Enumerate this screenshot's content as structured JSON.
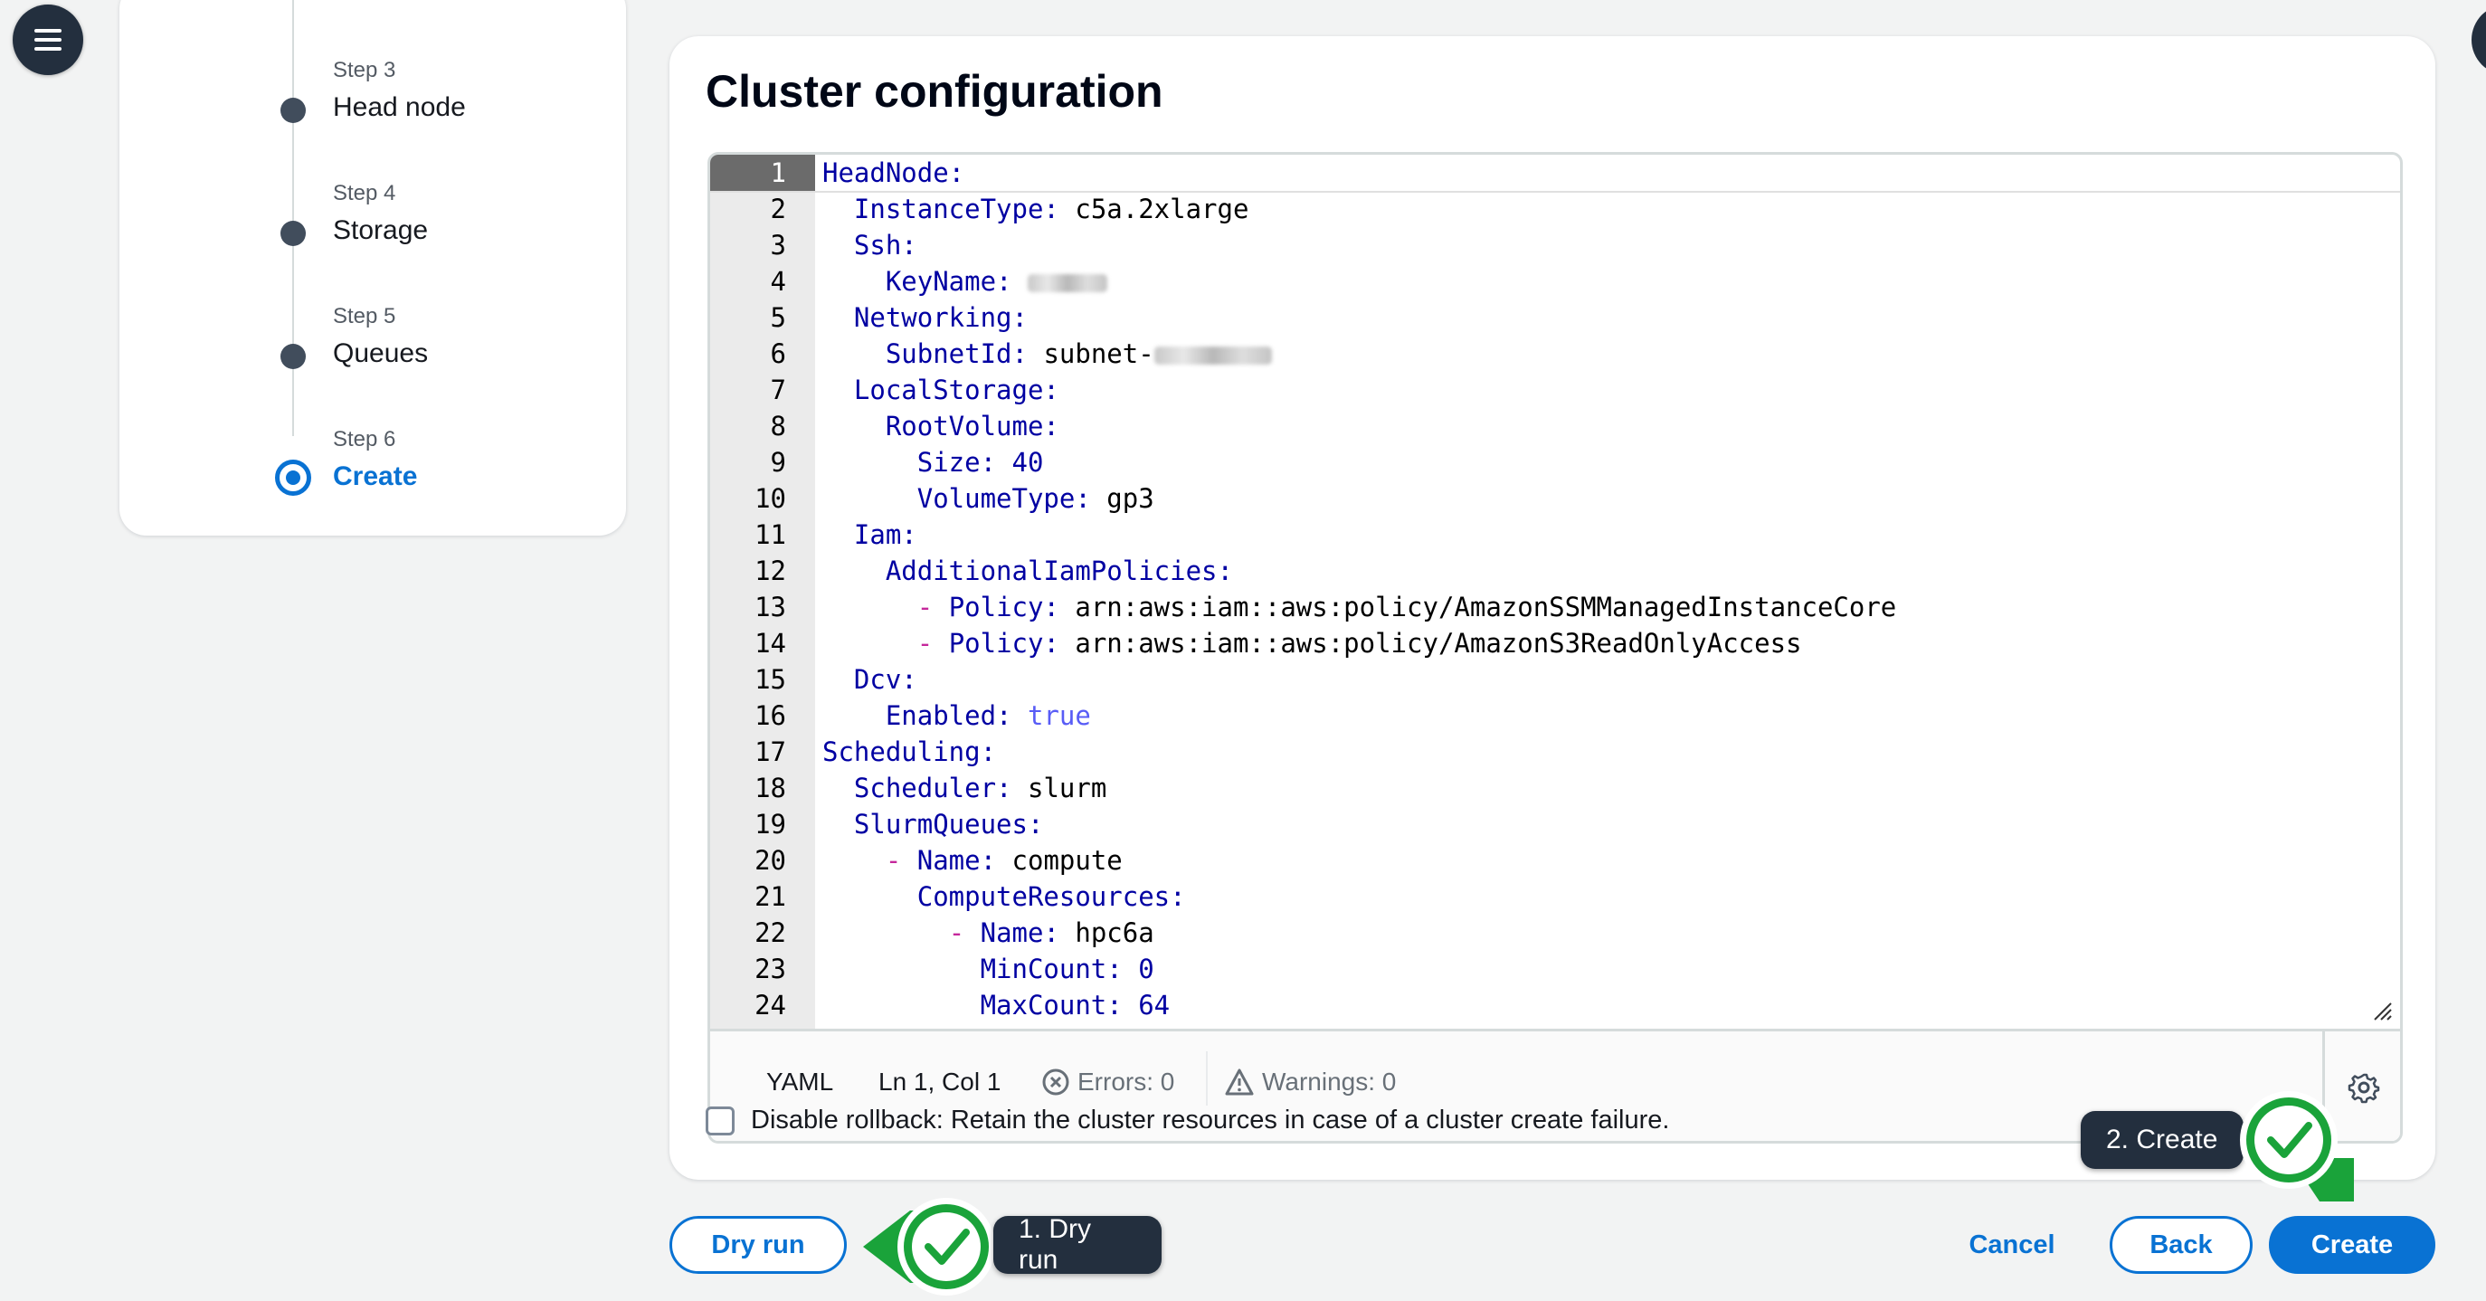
{
  "steps": [
    {
      "num": "Step 3",
      "label": "Head node"
    },
    {
      "num": "Step 4",
      "label": "Storage"
    },
    {
      "num": "Step 5",
      "label": "Queues"
    },
    {
      "num": "Step 6",
      "label": "Create"
    }
  ],
  "main": {
    "title": "Cluster configuration"
  },
  "editor": {
    "language": "YAML",
    "cursor": "Ln 1, Col 1",
    "errors": "Errors: 0",
    "warnings": "Warnings: 0",
    "lines": [
      {
        "n": "1"
      },
      {
        "n": "2"
      },
      {
        "n": "3"
      },
      {
        "n": "4"
      },
      {
        "n": "5"
      },
      {
        "n": "6"
      },
      {
        "n": "7"
      },
      {
        "n": "8"
      },
      {
        "n": "9"
      },
      {
        "n": "10"
      },
      {
        "n": "11"
      },
      {
        "n": "12"
      },
      {
        "n": "13"
      },
      {
        "n": "14"
      },
      {
        "n": "15"
      },
      {
        "n": "16"
      },
      {
        "n": "17"
      },
      {
        "n": "18"
      },
      {
        "n": "19"
      },
      {
        "n": "20"
      },
      {
        "n": "21"
      },
      {
        "n": "22"
      },
      {
        "n": "23"
      },
      {
        "n": "24"
      }
    ],
    "code": {
      "l1_key": "HeadNode:",
      "l2_key": "  InstanceType: ",
      "l2_val": "c5a.2xlarge",
      "l3_key": "  Ssh:",
      "l4_key": "    KeyName: ",
      "l5_key": "  Networking:",
      "l6_key": "    SubnetId: ",
      "l6_val": "subnet-",
      "l7_key": "  LocalStorage:",
      "l8_key": "    RootVolume:",
      "l9_key": "      Size: 40",
      "l10_key": "      VolumeType: ",
      "l10_val": "gp3",
      "l11_key": "  Iam:",
      "l12_key": "    AdditionalIamPolicies:",
      "l13_indent": "      ",
      "l13_dash": "- ",
      "l13_key": "Policy: ",
      "l13_val": "arn:aws:iam::aws:policy/AmazonSSMManagedInstanceCore",
      "l14_indent": "      ",
      "l14_dash": "- ",
      "l14_key": "Policy: ",
      "l14_val": "arn:aws:iam::aws:policy/AmazonS3ReadOnlyAccess",
      "l15_key": "  Dcv:",
      "l16_key": "    Enabled: ",
      "l16_val": "true",
      "l17_key": "Scheduling:",
      "l18_key": "  Scheduler: ",
      "l18_val": "slurm",
      "l19_key": "  SlurmQueues:",
      "l20_indent": "    ",
      "l20_dash": "- ",
      "l20_key": "Name: ",
      "l20_val": "compute",
      "l21_key": "      ComputeResources:",
      "l22_indent": "        ",
      "l22_dash": "- ",
      "l22_key": "Name: ",
      "l22_val": "hpc6a",
      "l23_key": "          MinCount: 0",
      "l24_key": "          MaxCount: 64"
    }
  },
  "rollback": {
    "label": "Disable rollback: Retain the cluster resources in case of a cluster create failure.",
    "checked": false
  },
  "actions": {
    "dry_run": "Dry run",
    "cancel": "Cancel",
    "back": "Back",
    "create": "Create"
  },
  "annotations": {
    "dry_run_callout": "1. Dry run",
    "create_callout": "2. Create",
    "badge_color": "#1aa33a"
  },
  "colors": {
    "accent": "#0972d3",
    "nav_dark": "#232f3e",
    "yaml_key": "#0000a2",
    "yaml_dash": "#c5279b",
    "yaml_bool": "#585cf6"
  }
}
